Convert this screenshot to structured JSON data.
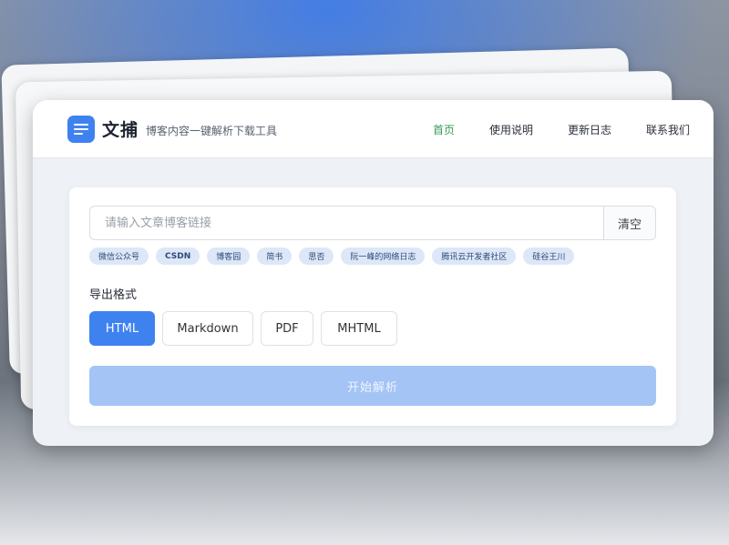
{
  "header": {
    "brand": "文捕",
    "tagline": "博客内容一键解析下载工具",
    "nav": [
      {
        "label": "首页",
        "active": true
      },
      {
        "label": "使用说明",
        "active": false
      },
      {
        "label": "更新日志",
        "active": false
      },
      {
        "label": "联系我们",
        "active": false
      }
    ]
  },
  "search": {
    "placeholder": "请输入文章博客链接",
    "value": "",
    "clear_label": "清空"
  },
  "tags": [
    "微信公众号",
    "CSDN",
    "博客园",
    "简书",
    "思否",
    "阮一峰的网络日志",
    "腾讯云开发者社区",
    "硅谷王川"
  ],
  "export": {
    "label": "导出格式",
    "formats": [
      "HTML",
      "Markdown",
      "PDF",
      "MHTML"
    ],
    "selected": "HTML"
  },
  "start_label": "开始解析",
  "colors": {
    "accent": "#3e82f0",
    "nav_active": "#3a9a5a",
    "start_disabled": "#a3c4f5",
    "tag_bg": "#dce7f7"
  },
  "icons": {
    "logo": "menu-lines-icon"
  }
}
